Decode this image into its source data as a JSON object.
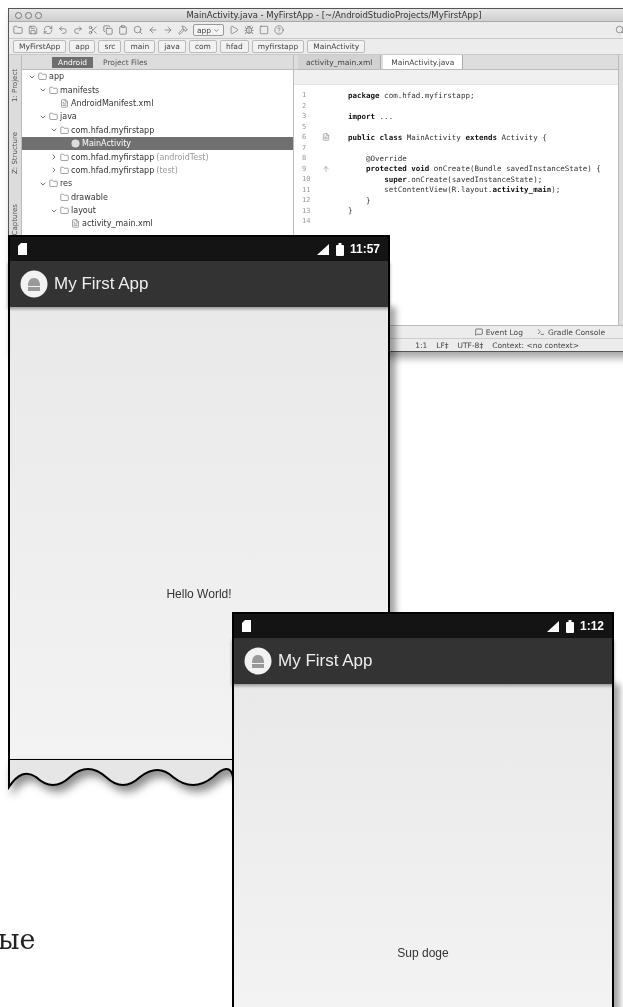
{
  "ide": {
    "title": "MainActivity.java - MyFirstApp - [~/AndroidStudioProjects/MyFirstApp]",
    "run_config": "app",
    "breadcrumbs": [
      "MyFirstApp",
      "app",
      "src",
      "main",
      "java",
      "com",
      "hfad",
      "myfirstapp",
      "MainActivity"
    ],
    "side_tabs": [
      "1: Project",
      "Z: Structure",
      "Captures"
    ],
    "tool_tabs": [
      {
        "label": "Android",
        "selected": true
      },
      {
        "label": "Project Files",
        "selected": false
      }
    ],
    "editor_tabs": [
      {
        "label": "activity_main.xml",
        "selected": false
      },
      {
        "label": "MainActivity.java",
        "selected": true
      }
    ],
    "tree": [
      {
        "label": "app",
        "kind": "folder",
        "expanded": true,
        "selected": false,
        "children": [
          {
            "label": "manifests",
            "kind": "folder",
            "expanded": true,
            "selected": false,
            "children": [
              {
                "label": "AndroidManifest.xml",
                "kind": "file",
                "selected": false
              }
            ]
          },
          {
            "label": "java",
            "kind": "folder",
            "expanded": true,
            "selected": false,
            "children": [
              {
                "label": "com.hfad.myfirstapp",
                "kind": "package",
                "expanded": true,
                "selected": false,
                "children": [
                  {
                    "label": "MainActivity",
                    "kind": "class",
                    "selected": true
                  }
                ]
              },
              {
                "label": "com.hfad.myfirstapp",
                "suffix": "(androidTest)",
                "kind": "package",
                "expanded": false,
                "selected": false
              },
              {
                "label": "com.hfad.myfirstapp",
                "suffix": "(test)",
                "kind": "package",
                "expanded": false,
                "selected": false
              }
            ]
          },
          {
            "label": "res",
            "kind": "folder",
            "expanded": true,
            "selected": false,
            "children": [
              {
                "label": "drawable",
                "kind": "package",
                "selected": false
              },
              {
                "label": "layout",
                "kind": "package",
                "expanded": true,
                "selected": false,
                "children": [
                  {
                    "label": "activity_main.xml",
                    "kind": "file",
                    "selected": false
                  }
                ]
              }
            ]
          }
        ]
      }
    ],
    "code_lines": [
      {
        "number": "1",
        "kind": "plain",
        "text": "**package** com.hfad.myfirstapp;"
      },
      {
        "number": "2",
        "kind": "plain"
      },
      {
        "number": "3",
        "kind": "plain",
        "text": "**import** ..."
      },
      {
        "number": "5",
        "kind": "plain"
      },
      {
        "number": "6",
        "kind": "class",
        "text": "**public class** MainActivity **extends** Activity {"
      },
      {
        "number": "7",
        "kind": "plain"
      },
      {
        "number": "8",
        "kind": "plain",
        "text": "    @Override"
      },
      {
        "number": "9",
        "kind": "override",
        "text": "    **protected void** onCreate(Bundle savedInstanceState) {"
      },
      {
        "number": "10",
        "kind": "plain",
        "text": "        **super**.onCreate(savedInstanceState);"
      },
      {
        "number": "11",
        "kind": "plain",
        "text": "        setContentView(R.layout.**activity_main**);"
      },
      {
        "number": "12",
        "kind": "plain",
        "text": "    }"
      },
      {
        "number": "13",
        "kind": "plain",
        "text": "}"
      },
      {
        "number": "14",
        "kind": "plain"
      }
    ],
    "tool_buttons": [
      "Event Log",
      "Gradle Console"
    ],
    "status_items": [
      "1:1",
      "LF‡",
      "UTF-8‡",
      "Context: <no context>"
    ]
  },
  "phones": [
    {
      "time": "11:57",
      "app_title": "My First App",
      "message": "Hello World!",
      "torn_edge": true
    },
    {
      "time": "1:12",
      "app_title": "My First App",
      "message": "Sup doge",
      "torn_edge": false
    }
  ],
  "page_text": "ые"
}
